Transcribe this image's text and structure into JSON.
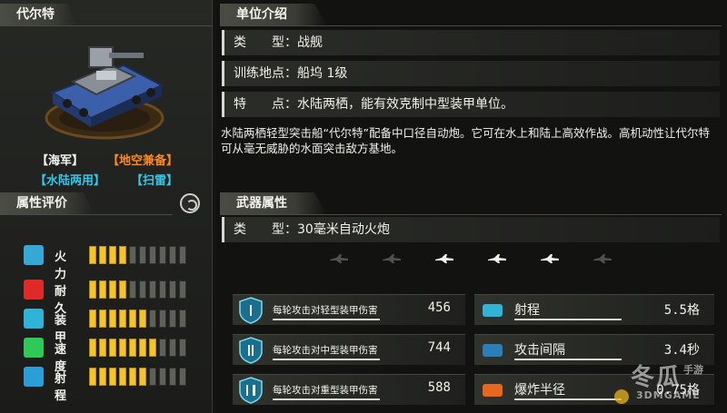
{
  "unit": {
    "name": "代尔特",
    "tags": [
      {
        "text": "【海军】",
        "color": "#f4f4f4"
      },
      {
        "text": "【地空兼备】",
        "color": "#ff8a1f"
      },
      {
        "text": "【水陆两用】",
        "color": "#36c6e8"
      },
      {
        "text": "【扫雷】",
        "color": "#36c6e8"
      }
    ]
  },
  "attributes": {
    "title": "属性评价",
    "rows": [
      {
        "label": "火力",
        "level": 4,
        "max": 10,
        "icon": "firepower-icon",
        "color": "#35a8d6"
      },
      {
        "label": "耐久",
        "level": 4,
        "max": 10,
        "icon": "heart-icon",
        "color": "#e02a2a"
      },
      {
        "label": "装甲",
        "level": 6,
        "max": 10,
        "icon": "shield-icon",
        "color": "#2fb4d8"
      },
      {
        "label": "速度",
        "level": 7,
        "max": 10,
        "icon": "speed-chevron-icon",
        "color": "#2fc85a"
      },
      {
        "label": "射程",
        "level": 6,
        "max": 10,
        "icon": "range-arrows-icon",
        "color": "#2b9ed8"
      }
    ]
  },
  "intro": {
    "title": "单位介绍",
    "type_label": "类　　型：",
    "type_value": "战舰",
    "train_label": "训练地点：",
    "train_value": "船坞 1级",
    "feature_label": "特　　点：",
    "feature_value": "水陆两栖，能有效克制中型装甲单位。",
    "description": "水陆两栖轻型突击船“代尔特”配备中口径自动炮。它可在水上和陆上高效作战。高机动性让代尔特可从毫无威胁的水面突击敌方基地。"
  },
  "weapon": {
    "title": "武器属性",
    "type_label": "类　　型：",
    "type_value": "30毫米自动火炮",
    "targets": [
      {
        "icon": "jet-icon",
        "active": false
      },
      {
        "icon": "plane-icon",
        "active": false
      },
      {
        "icon": "helicopter-icon",
        "active": true
      },
      {
        "icon": "tank-icon",
        "active": true
      },
      {
        "icon": "ship-icon",
        "active": true
      },
      {
        "icon": "submarine-icon",
        "active": false
      }
    ],
    "damage": [
      {
        "label": "每轮攻击对轻型装甲伤害",
        "value": "456",
        "icon": "armor-light-icon"
      },
      {
        "label": "每轮攻击对中型装甲伤害",
        "value": "744",
        "icon": "armor-medium-icon"
      },
      {
        "label": "每轮攻击对重型装甲伤害",
        "value": "588",
        "icon": "armor-heavy-icon"
      }
    ],
    "stats": [
      {
        "label": "射程",
        "value": "5.5格",
        "icon": "range-icon"
      },
      {
        "label": "攻击间隔",
        "value": "3.4秒",
        "icon": "hourglass-icon"
      },
      {
        "label": "爆炸半径",
        "value": "0.75格",
        "icon": "explosion-icon"
      }
    ]
  },
  "watermark": {
    "main": "冬瓜",
    "sub": "手游",
    "url": "3DMGAME"
  }
}
